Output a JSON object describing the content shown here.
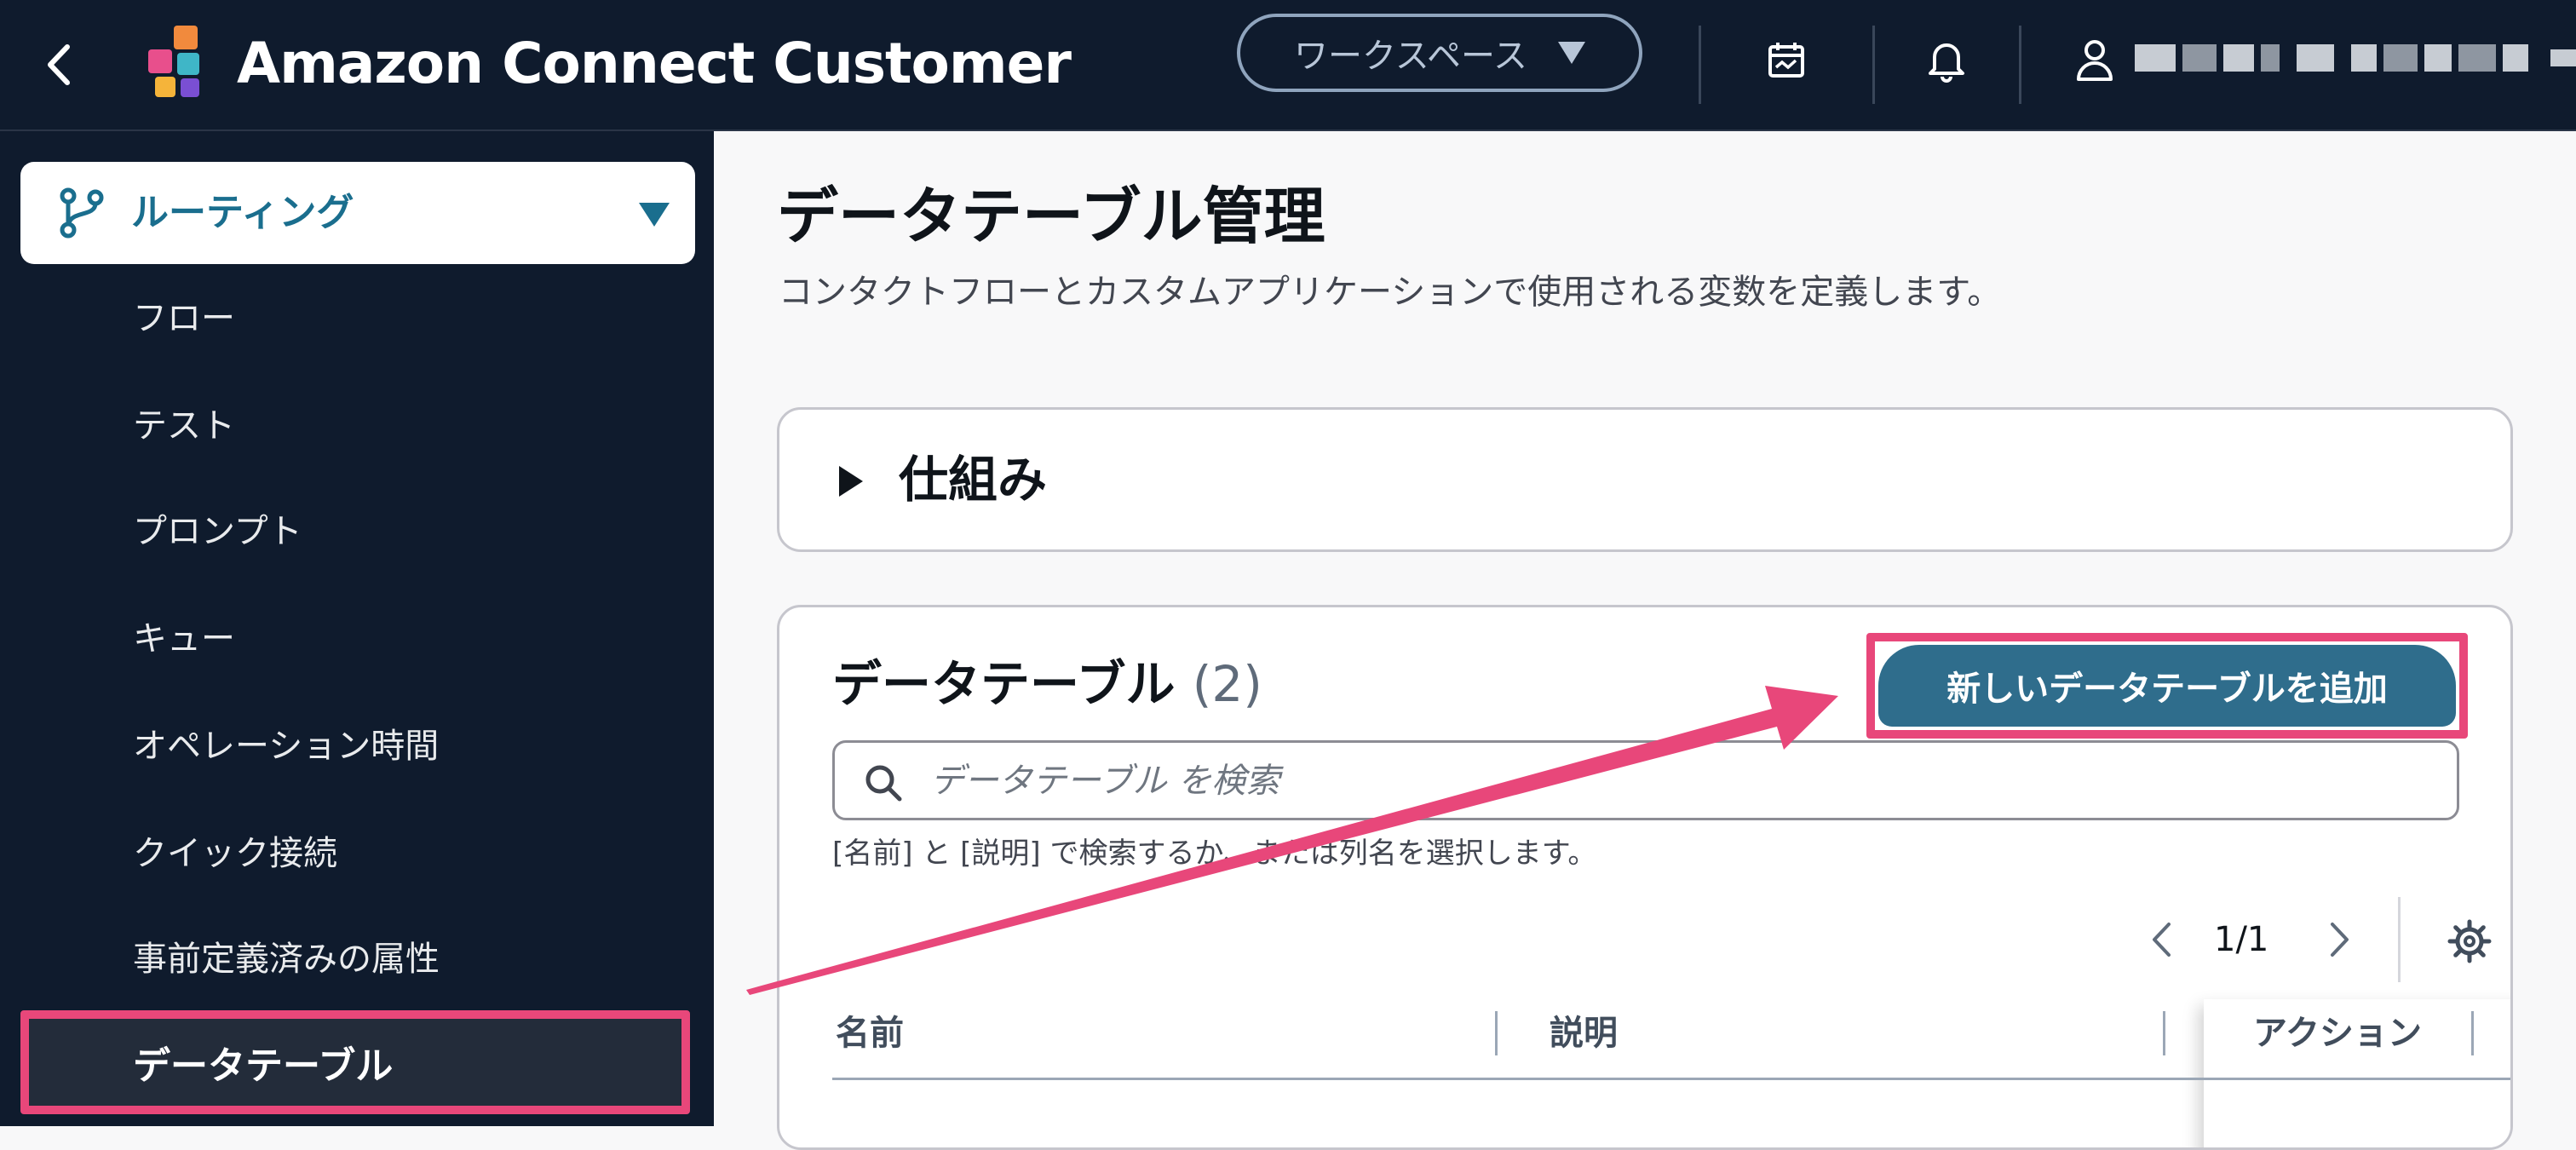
{
  "header": {
    "back_label": "",
    "app_title": "Amazon Connect Customer",
    "workspace_label": "ワークスペース",
    "colors": {
      "bar": "#0f1b2d",
      "accent": "#1a6e8e",
      "highlight": "#e8477a"
    }
  },
  "sidebar": {
    "section_label": "ルーティング",
    "items": [
      {
        "label": "フロー"
      },
      {
        "label": "テスト"
      },
      {
        "label": "プロンプト"
      },
      {
        "label": "キュー"
      },
      {
        "label": "オペレーション時間"
      },
      {
        "label": "クイック接続"
      },
      {
        "label": "事前定義済みの属性"
      },
      {
        "label": "データテーブル"
      }
    ]
  },
  "main": {
    "title": "データテーブル管理",
    "description": "コンタクトフローとカスタムアプリケーションで使用される変数を定義します。",
    "how_it_works": "仕組み",
    "datatables": {
      "title": "データテーブル",
      "count": "(2)",
      "add_button": "新しいデータテーブルを追加",
      "search_placeholder": "データテーブル を検索",
      "hint": "[名前] と [説明] で検索するか、または列名を選択します。",
      "page": "1/1",
      "columns": [
        "名前",
        "説明",
        "アクション"
      ]
    }
  }
}
